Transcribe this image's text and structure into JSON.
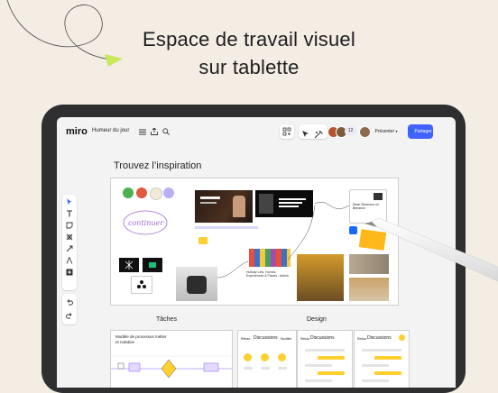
{
  "headline": {
    "line1": "Espace de travail visuel",
    "line2": "sur tablette"
  },
  "app": {
    "brand": "miro",
    "board_name": "Humeur du jour",
    "collaborator_count": "12",
    "present_label": "Présenter",
    "share_label": "Partager",
    "accent_color": "#4262ff"
  },
  "canvas": {
    "title": "Trouvez l’inspiration",
    "sticker_text": "continuer",
    "link_text": "Holiday Lets, Homes, Experiences & Places - Airbnb",
    "card_text": "Dean Simmons on Behance",
    "swatch_colors": [
      "#4caf50",
      "#e05a3f",
      "#f2ead6",
      "#b8b0f5"
    ],
    "sections": {
      "tasks_label": "Tâches",
      "design_label": "Design",
      "process_title_line1": "Modèle de processus métier",
      "process_title_line2": "et notation"
    },
    "discussions": [
      {
        "back": "Retour",
        "title": "Discussions",
        "action": "Modifier"
      },
      {
        "back": "Retour",
        "title": "Discussions"
      },
      {
        "back": "Retour",
        "title": "Discussions"
      }
    ]
  }
}
